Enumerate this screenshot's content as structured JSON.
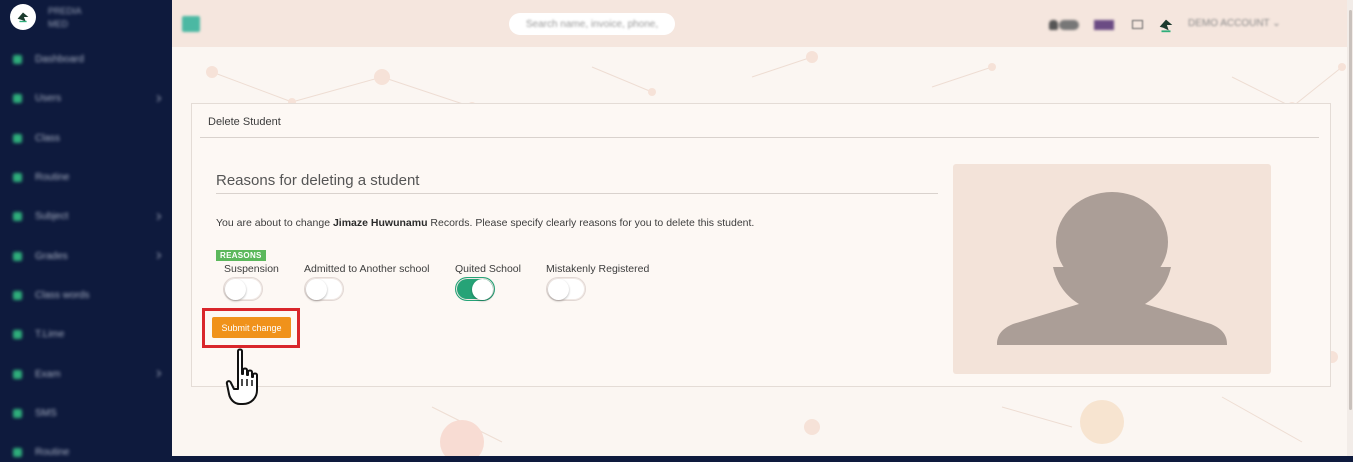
{
  "app": {
    "brand_line1": "PREDIA",
    "brand_line2": "MED"
  },
  "sidebar": {
    "items": [
      {
        "label": "Dashboard",
        "icon": "dashboard-icon",
        "has_caret": false
      },
      {
        "label": "Users",
        "icon": "users-icon",
        "has_caret": true
      },
      {
        "label": "Class",
        "icon": "class-icon",
        "has_caret": false
      },
      {
        "label": "Routine",
        "icon": "routine-icon",
        "has_caret": false
      },
      {
        "label": "Subject",
        "icon": "subject-icon",
        "has_caret": true
      },
      {
        "label": "Grades",
        "icon": "grades-icon",
        "has_caret": true
      },
      {
        "label": "Class words",
        "icon": "class-words-icon",
        "has_caret": false
      },
      {
        "label": "T.Lime",
        "icon": "chart-icon",
        "has_caret": false
      },
      {
        "label": "Exam",
        "icon": "exam-icon",
        "has_caret": true
      },
      {
        "label": "SMS",
        "icon": "sms-icon",
        "has_caret": false
      },
      {
        "label": "Routine",
        "icon": "routine-icon",
        "has_caret": false
      }
    ]
  },
  "header": {
    "search_placeholder": "Search name, invoice, phone, ",
    "notification_count": "",
    "account_label": "DEMO ACCOUNT ⌄"
  },
  "card": {
    "title": "Delete Student",
    "section_title": "Reasons for deleting a student",
    "notice_prefix": "You are about to change ",
    "student_name": "Jimaze Huwunamu",
    "notice_suffix": " Records. Please specify clearly reasons for you to delete this student.",
    "badge": "REASONS",
    "reasons": [
      {
        "label": "Suspension",
        "checked": false
      },
      {
        "label": "Admitted to Another school",
        "checked": false
      },
      {
        "label": "Quited School",
        "checked": true
      },
      {
        "label": "Mistakenly Registered",
        "checked": false
      }
    ],
    "submit_label": "Submit change"
  },
  "colors": {
    "sidebar_bg": "#0e1a3d",
    "accent_green": "#26a377",
    "submit_orange": "#f0921b",
    "highlight_red": "#d9262b",
    "badge_green": "#5cb85c",
    "topbar_bg": "#f5e6de",
    "avatar_silhouette": "#ab9e97"
  }
}
